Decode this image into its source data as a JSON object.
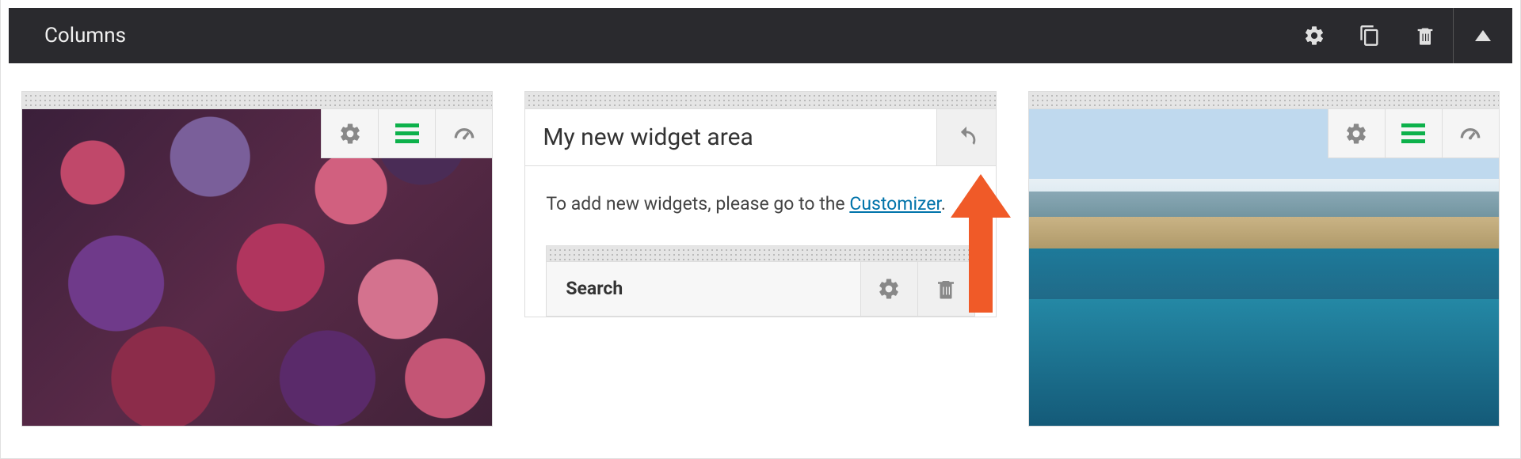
{
  "header": {
    "title": "Columns"
  },
  "widgetArea": {
    "title": "My new widget area",
    "hint_prefix": "To add new widgets, please go to the ",
    "customizer_link": "Customizer",
    "hint_suffix": "."
  },
  "searchWidget": {
    "label": "Search"
  }
}
